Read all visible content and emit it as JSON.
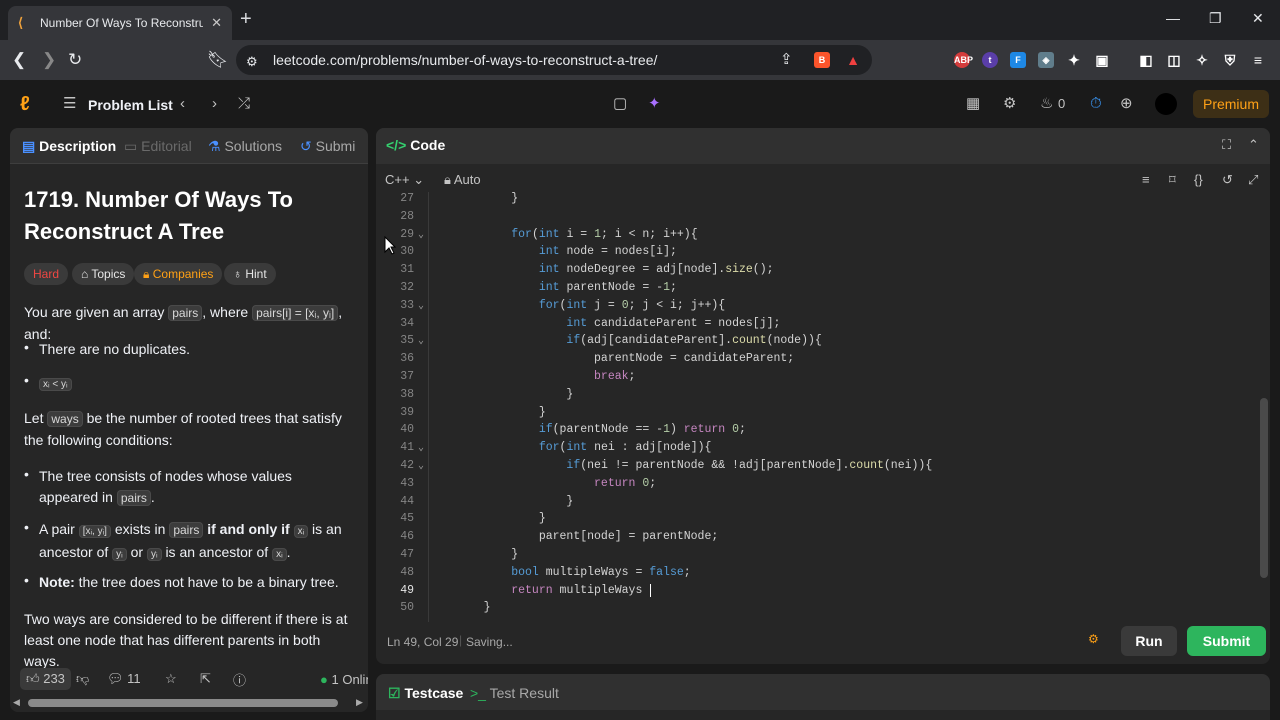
{
  "browser": {
    "tab_title": "Number Of Ways To Reconstruct",
    "url": "leetcode.com/problems/number-of-ways-to-reconstruct-a-tree/"
  },
  "header": {
    "problem_list": "Problem List",
    "streak_count": "0",
    "premium": "Premium"
  },
  "left_tabs": [
    "Description",
    "Editorial",
    "Solutions",
    "Submi"
  ],
  "problem": {
    "title": "1719. Number Of Ways To Reconstruct A Tree",
    "difficulty": "Hard",
    "chips": [
      "Topics",
      "Companies",
      "Hint"
    ],
    "intro_a": "You are given an array",
    "intro_code1": "pairs",
    "intro_b": ", where",
    "intro_code2": "pairs[i] = [xᵢ, yᵢ]",
    "intro_c": ", and:",
    "bullet1": "There are no duplicates.",
    "bullet2_code": "xᵢ < yᵢ",
    "let_a": "Let",
    "let_code": "ways",
    "let_b": "be the number of rooted trees that satisfy the following conditions:",
    "cond1_a": "The tree consists of nodes whose values appeared in",
    "cond1_code": "pairs",
    "cond1_b": ".",
    "cond2_a": "A pair",
    "cond2_code1": "[xᵢ, yᵢ]",
    "cond2_b": "exists in",
    "cond2_code2": "pairs",
    "cond2_c": "if and only if",
    "cond2_code3": "xᵢ",
    "cond2_d": "is an ancestor of",
    "cond2_code4": "yᵢ",
    "cond2_e": "or",
    "cond2_code5": "yᵢ",
    "cond2_f": "is an ancestor of",
    "cond2_code6": "xᵢ",
    "cond2_g": ".",
    "cond3_bold": "Note:",
    "cond3_rest": "the tree does not have to be a binary tree.",
    "two_ways": "Two ways are considered to be different if there is at least one node that has different parents in both ways."
  },
  "footer": {
    "likes": "233",
    "comments": "11",
    "online": "1 Onlin"
  },
  "code_panel": {
    "title": "Code",
    "language": "C++",
    "mode": "Auto",
    "status_pos": "Ln 49, Col 29",
    "status_save": "Saving...",
    "run": "Run",
    "submit": "Submit"
  },
  "code_lines": [
    {
      "n": "27",
      "t": "        }"
    },
    {
      "n": "28",
      "t": ""
    },
    {
      "n": "29",
      "t": "        for(int i = 1; i < n; i++){"
    },
    {
      "n": "30",
      "t": "            int node = nodes[i];"
    },
    {
      "n": "31",
      "t": "            int nodeDegree = adj[node].size();"
    },
    {
      "n": "32",
      "t": "            int parentNode = -1;"
    },
    {
      "n": "33",
      "t": "            for(int j = 0; j < i; j++){"
    },
    {
      "n": "34",
      "t": "                int candidateParent = nodes[j];"
    },
    {
      "n": "35",
      "t": "                if(adj[candidateParent].count(node)){"
    },
    {
      "n": "36",
      "t": "                    parentNode = candidateParent;"
    },
    {
      "n": "37",
      "t": "                    break;"
    },
    {
      "n": "38",
      "t": "                }"
    },
    {
      "n": "39",
      "t": "            }"
    },
    {
      "n": "40",
      "t": "            if(parentNode == -1) return 0;"
    },
    {
      "n": "41",
      "t": "            for(int nei : adj[node]){"
    },
    {
      "n": "42",
      "t": "                if(nei != parentNode && !adj[parentNode].count(nei)){"
    },
    {
      "n": "43",
      "t": "                    return 0;"
    },
    {
      "n": "44",
      "t": "                }"
    },
    {
      "n": "45",
      "t": "            }"
    },
    {
      "n": "46",
      "t": "            parent[node] = parentNode;"
    },
    {
      "n": "47",
      "t": "        }"
    },
    {
      "n": "48",
      "t": "        bool multipleWays = false;"
    },
    {
      "n": "49",
      "t": "        return multipleWays "
    },
    {
      "n": "50",
      "t": "    }"
    }
  ],
  "test_tabs": [
    "Testcase",
    "Test Result"
  ]
}
